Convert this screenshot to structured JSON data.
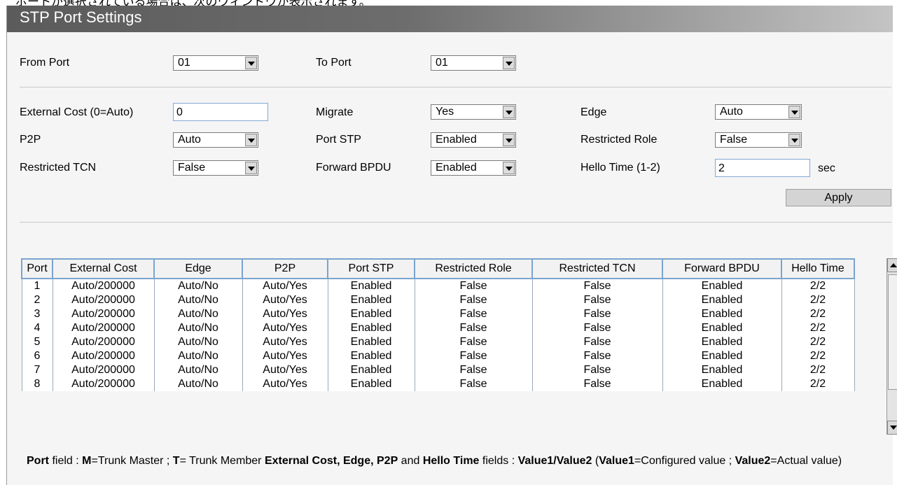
{
  "caption_fragment": "ポートが選択されている場合は、次のウィンドウが表示されます。",
  "title": "STP Port Settings",
  "form": {
    "from_port": {
      "label": "From Port",
      "value": "01"
    },
    "to_port": {
      "label": "To Port",
      "value": "01"
    },
    "external_cost": {
      "label": "External Cost (0=Auto)",
      "value": "0"
    },
    "migrate": {
      "label": "Migrate",
      "value": "Yes"
    },
    "edge": {
      "label": "Edge",
      "value": "Auto"
    },
    "p2p": {
      "label": "P2P",
      "value": "Auto"
    },
    "port_stp": {
      "label": "Port STP",
      "value": "Enabled"
    },
    "restricted_role": {
      "label": "Restricted Role",
      "value": "False"
    },
    "restricted_tcn": {
      "label": "Restricted TCN",
      "value": "False"
    },
    "forward_bpdu": {
      "label": "Forward BPDU",
      "value": "Enabled"
    },
    "hello_time": {
      "label": "Hello Time (1-2)",
      "value": "2",
      "unit": "sec"
    },
    "apply_label": "Apply"
  },
  "table": {
    "headers": [
      "Port",
      "External Cost",
      "Edge",
      "P2P",
      "Port STP",
      "Restricted Role",
      "Restricted TCN",
      "Forward BPDU",
      "Hello Time"
    ],
    "rows": [
      [
        "1",
        "Auto/200000",
        "Auto/No",
        "Auto/Yes",
        "Enabled",
        "False",
        "False",
        "Enabled",
        "2/2"
      ],
      [
        "2",
        "Auto/200000",
        "Auto/No",
        "Auto/Yes",
        "Enabled",
        "False",
        "False",
        "Enabled",
        "2/2"
      ],
      [
        "3",
        "Auto/200000",
        "Auto/No",
        "Auto/Yes",
        "Enabled",
        "False",
        "False",
        "Enabled",
        "2/2"
      ],
      [
        "4",
        "Auto/200000",
        "Auto/No",
        "Auto/Yes",
        "Enabled",
        "False",
        "False",
        "Enabled",
        "2/2"
      ],
      [
        "5",
        "Auto/200000",
        "Auto/No",
        "Auto/Yes",
        "Enabled",
        "False",
        "False",
        "Enabled",
        "2/2"
      ],
      [
        "6",
        "Auto/200000",
        "Auto/No",
        "Auto/Yes",
        "Enabled",
        "False",
        "False",
        "Enabled",
        "2/2"
      ],
      [
        "7",
        "Auto/200000",
        "Auto/No",
        "Auto/Yes",
        "Enabled",
        "False",
        "False",
        "Enabled",
        "2/2"
      ],
      [
        "8",
        "Auto/200000",
        "Auto/No",
        "Auto/Yes",
        "Enabled",
        "False",
        "False",
        "Enabled",
        "2/2"
      ]
    ]
  },
  "notes": {
    "port_b": "Port",
    "t1": " field : ",
    "m_b": "M",
    "t2": "=Trunk Master ; ",
    "tm_b": "T",
    "t3": "= Trunk Member   ",
    "fields_b": "External Cost, Edge, P2P",
    "t4": " and ",
    "hello_b": "Hello Time",
    "t5": " fields :   ",
    "v12_b": "Value1/Value2",
    "t6": " (",
    "v1_b": "Value1",
    "t7": "=Configured value ; ",
    "v2_b": "Value2",
    "t8": "=Actual value)"
  }
}
